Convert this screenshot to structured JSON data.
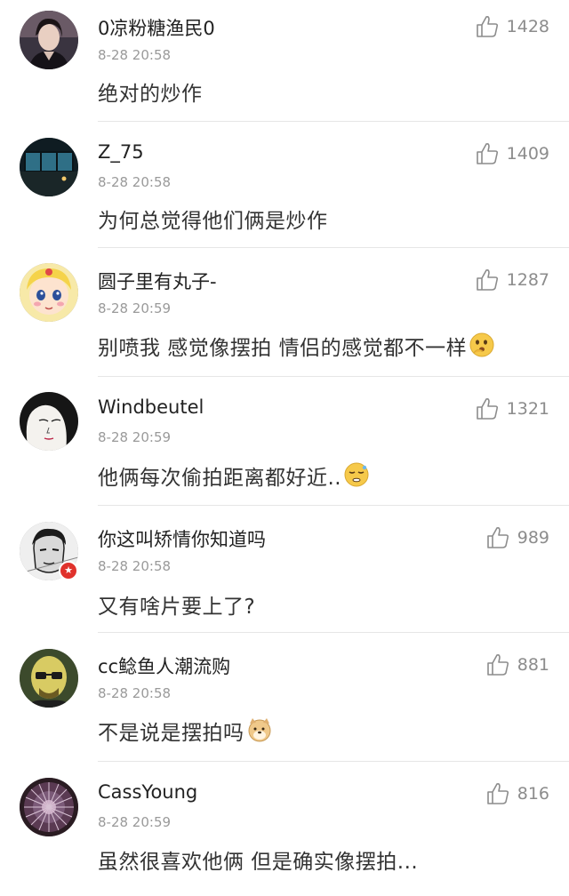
{
  "comments": [
    {
      "username": "0凉粉糖渔民0",
      "time": "8-28 20:58",
      "text": "绝对的炒作",
      "likes": "1428",
      "avatar": "woman-portrait-avatar"
    },
    {
      "username": "Z_75",
      "time": "8-28 20:58",
      "text": "为何总觉得他们俩是炒作",
      "likes": "1409",
      "avatar": "night-window-avatar"
    },
    {
      "username": "圆子里有丸子-",
      "time": "8-28 20:59",
      "text": "别喷我 感觉像摆拍 情侣的感觉都不一样",
      "likes": "1287",
      "avatar": "cartoon-girl-avatar",
      "emoji": "thinking-emoji"
    },
    {
      "username": "Windbeutel",
      "time": "8-28 20:59",
      "text": "他俩每次偷拍距离都好近..",
      "likes": "1321",
      "avatar": "manga-face-avatar",
      "emoji": "sleepy-emoji"
    },
    {
      "username": "你这叫矫情你知道吗",
      "time": "8-28 20:58",
      "text": "又有啥片要上了?",
      "likes": "989",
      "avatar": "comic-fighter-avatar",
      "badge": "verified-badge"
    },
    {
      "username": "cc鲶鱼人潮流购",
      "time": "8-28 20:58",
      "text": "不是说是摆拍吗",
      "likes": "881",
      "avatar": "bald-man-avatar",
      "emoji": "doge-emoji"
    },
    {
      "username": "CassYoung",
      "time": "8-28 20:59",
      "text": "虽然很喜欢他俩 但是确实像摆拍...",
      "likes": "816",
      "avatar": "sea-urchin-avatar"
    }
  ],
  "icons": {
    "like": "thumbs-up-icon"
  },
  "colors": {
    "username": "#222222",
    "time": "#9a9a9a",
    "text": "#333333",
    "like": "#8c8c8c",
    "divider": "#e6e6e6"
  }
}
